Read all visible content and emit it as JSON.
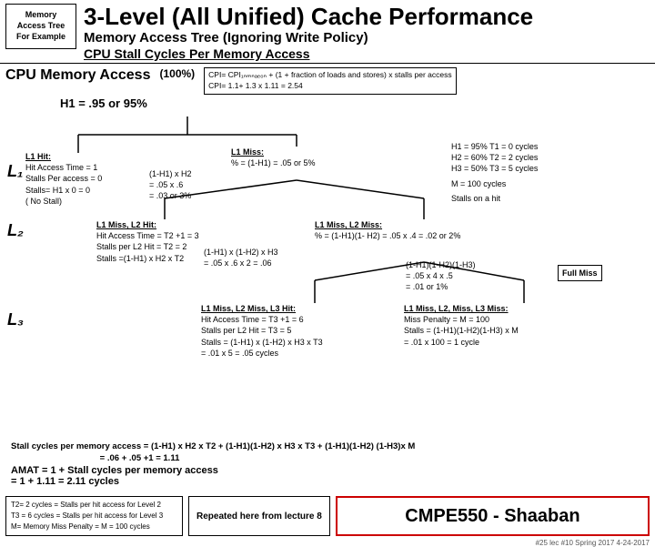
{
  "header": {
    "memory_label": "Memory Access Tree For Example",
    "main_title": "3-Level (All Unified) Cache Performance",
    "sub_title": "Memory Access Tree (Ignoring Write Policy)",
    "sub_title2": "CPU  Stall Cycles Per Memory Access"
  },
  "cpu_line": {
    "label": "CPU Memory Access",
    "pct": "(100%)",
    "cpi_line1": "CPI= CPI₁ₙₘₙₐₑ₀ₙ + (1 + fraction of loads and stores) x stalls per access",
    "cpi_line2": "CPI=    1.1+                  1.3 x 1.11 = 2.54"
  },
  "h1_line": "H1 = .95 or  95%",
  "l1": "L₁",
  "l2": "L₂",
  "l3": "L₃",
  "nodes": {
    "l1_hit": {
      "title": "L1  Hit:",
      "line1": "Hit Access Time = 1",
      "line2": "Stalls Per access = 0",
      "line3": "Stalls= H1 x 0 = 0",
      "line4": "( No Stall)"
    },
    "l1_miss_pct": {
      "label": "L1 Miss:",
      "formula": "% = (1-H1) = .05 or  5%"
    },
    "l1_h2": {
      "line1": "(1-H1) x H2",
      "line2": "= .05 x .6",
      "line3": "= .03 or 3%"
    },
    "l1_miss_l2_hit": {
      "title": "L1 Miss, L2  Hit:",
      "line1": "Hit Access Time = T2 +1 = 3",
      "line2": "Stalls per L2 Hit = T2 = 2",
      "line3": "Stalls =(1-H1) x H2 x T2"
    },
    "l1_h2_val": {
      "line1": "(1-H1) x (1-H2) x H3",
      "line2": "= .05 x .6 x 2 = .06"
    },
    "l1_miss_l2_miss": {
      "label": "L1 Miss, L2  Miss:",
      "formula": "% =  (1-H1)(1- H2) = .05 x .4 = .02 or 2%"
    },
    "l1_h1h2h3": {
      "line1": "(1-H1)(1-H2)(1-H3)",
      "line2": "= .05 x 4 x .5",
      "line3": "= .01 or 1%"
    },
    "l1_miss_l2_hit_l3_hit": {
      "title": "L1 Miss, L2 Miss, L3  Hit:",
      "line1": "Hit Access Time = T3 +1 = 6",
      "line2": "Stalls per L2 Hit = T3 = 5",
      "line3": "Stalls = (1-H1) x (1-H2) x H3 x T3",
      "line4": "= .01 x 5 = .05 cycles"
    },
    "l1_miss_l2_miss_l3_miss": {
      "title": "L1 Miss, L2, Miss, L3  Miss:",
      "line1": "Miss Penalty = M = 100",
      "line2": "Stalls = (1-H1)(1-H2)(1-H3) x M",
      "line3": "= .01 x 100 = 1 cycle"
    },
    "full_miss": "Full Miss",
    "right_info": {
      "line1": "H1 = 95%     T1 = 0 cycles",
      "line2": "H2 = 60%     T2 = 2 cycles",
      "line3": "H3 = 50%     T3 = 5 cycles",
      "line4": "",
      "line5": "M = 100 cycles",
      "line6": "Stalls on a hit"
    }
  },
  "stall_line": {
    "label": "Stall cycles per memory access",
    "formula": "= (1-H1) x H2 x T2 + (1-H1)(1-H2) x H3 x T3  + (1-H1)(1-H2) (1-H3)x M",
    "formula2": "= .06                    +        .05               +1   = 1.11"
  },
  "amat": {
    "line1": "AMAT  =  1 + Stall cycles per memory access",
    "line2": "= 1 + 1.11 = 2.11 cycles"
  },
  "legend": {
    "line1": "T2= 2 cycles = Stalls per hit access for Level 2",
    "line2": "T3 = 6 cycles =  Stalls per hit access for Level 3",
    "line3": "M= Memory Miss Penalty = M = 100 cycles"
  },
  "repeated": "Repeated here from lecture 8",
  "cmpe": "CMPE550 - Shaaban",
  "slide_num": "#25  lec #10   Spring 2017   4-24-2017"
}
